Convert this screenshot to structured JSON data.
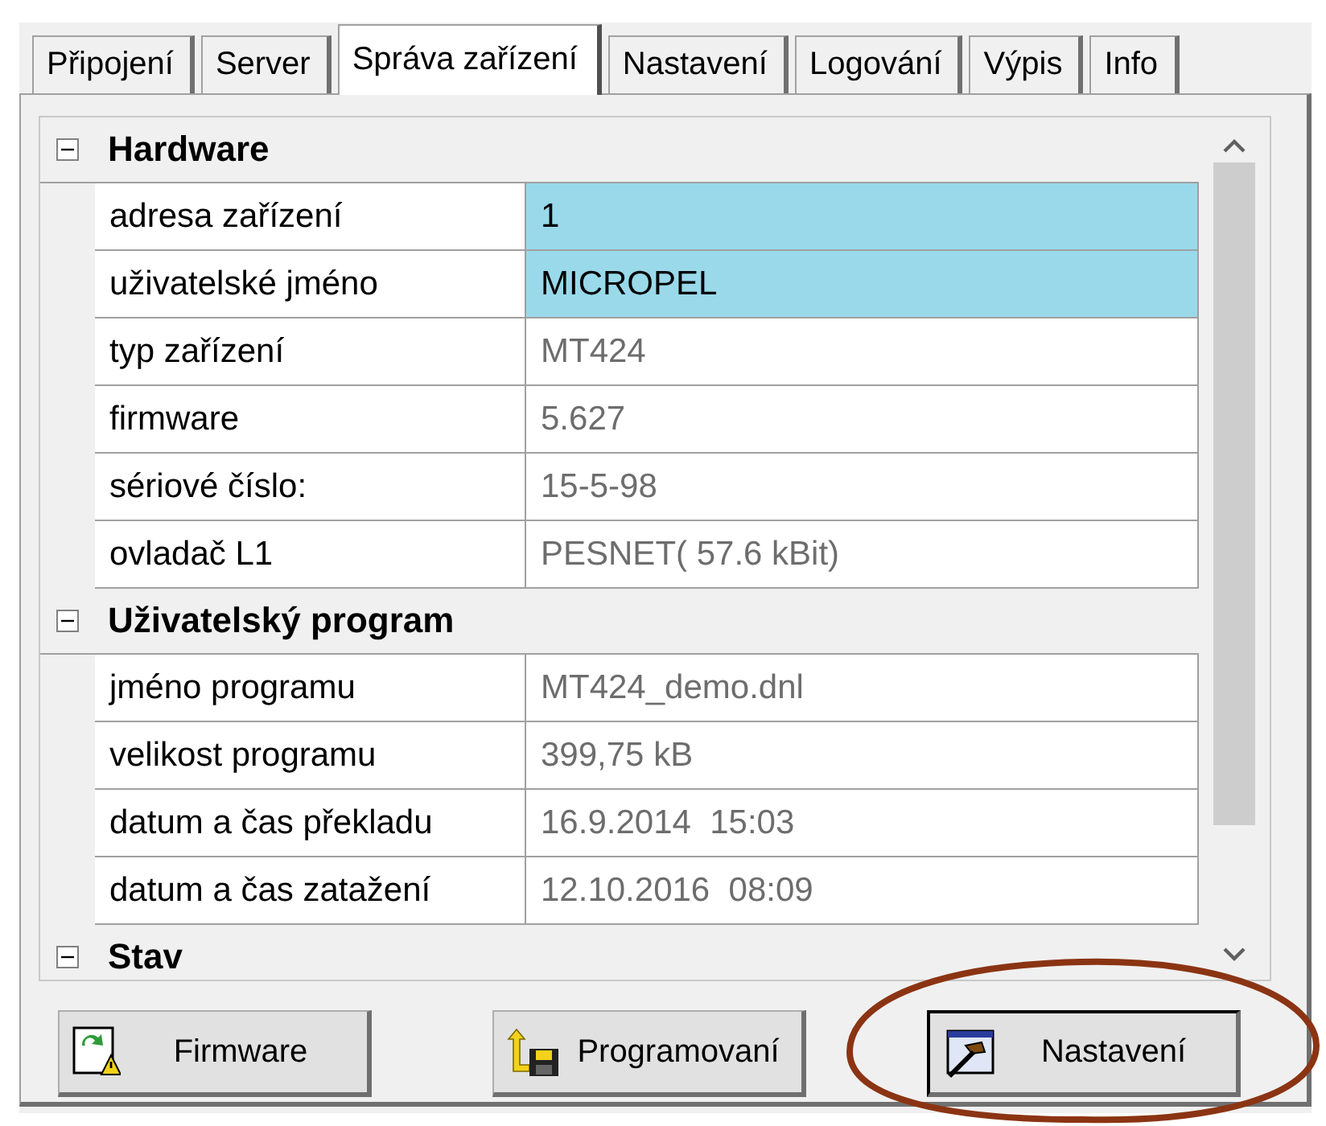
{
  "tabs": [
    {
      "label": "Připojení",
      "selected": false
    },
    {
      "label": "Server",
      "selected": false
    },
    {
      "label": "Správa zařízení",
      "selected": true
    },
    {
      "label": "Nastavení",
      "selected": false
    },
    {
      "label": "Logování",
      "selected": false
    },
    {
      "label": "Výpis",
      "selected": false
    },
    {
      "label": "Info",
      "selected": false
    }
  ],
  "property_grid": {
    "categories": [
      {
        "title": "Hardware",
        "expanded": true,
        "rows": [
          {
            "label": "adresa zařízení",
            "value": "1",
            "editable": true
          },
          {
            "label": "uživatelské jméno",
            "value": "MICROPEL",
            "editable": true
          },
          {
            "label": "typ zařízení",
            "value": "MT424",
            "editable": false
          },
          {
            "label": "firmware",
            "value": "5.627",
            "editable": false
          },
          {
            "label": "sériové číslo:",
            "value": "15-5-98",
            "editable": false
          },
          {
            "label": "ovladač L1",
            "value": "PESNET( 57.6 kBit)",
            "editable": false
          }
        ]
      },
      {
        "title": "Uživatelský program",
        "expanded": true,
        "rows": [
          {
            "label": "jméno programu",
            "value": "MT424_demo.dnl",
            "editable": false
          },
          {
            "label": "velikost programu",
            "value": "399,75 kB",
            "editable": false
          },
          {
            "label": "datum a čas překladu",
            "value": "16.9.2014  15:03",
            "editable": false
          },
          {
            "label": "datum a čas zatažení",
            "value": "12.10.2016  08:09",
            "editable": false
          }
        ]
      },
      {
        "title": "Stav",
        "expanded": true
      }
    ]
  },
  "buttons": [
    {
      "kind": "firmware",
      "label": "Firmware",
      "focused": false
    },
    {
      "kind": "program",
      "label": "Programovaní",
      "focused": false
    },
    {
      "kind": "settings",
      "label": "Nastavení",
      "focused": true
    }
  ],
  "annotation": {
    "kind": "ellipse",
    "color": "#8b3413"
  }
}
